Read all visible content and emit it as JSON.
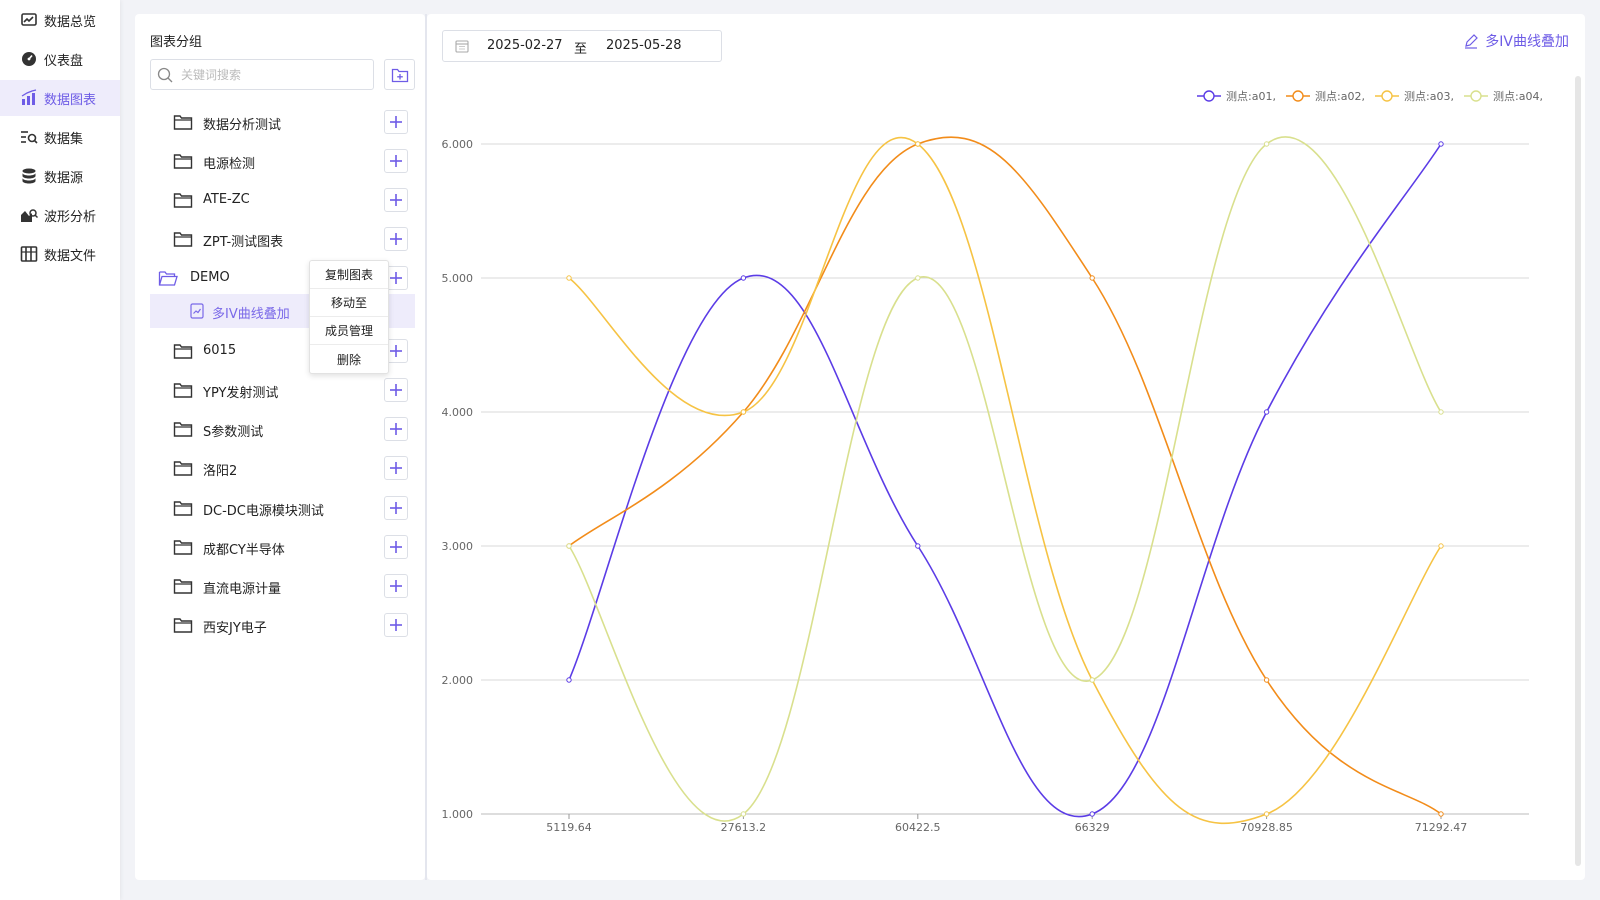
{
  "nav": {
    "items": [
      {
        "label": "数据总览",
        "icon": "chart-monitor-icon",
        "active": false
      },
      {
        "label": "仪表盘",
        "icon": "dashboard-gauge-icon",
        "active": false
      },
      {
        "label": "数据图表",
        "icon": "bar-chart-icon",
        "active": true
      },
      {
        "label": "数据集",
        "icon": "dataset-search-icon",
        "active": false
      },
      {
        "label": "数据源",
        "icon": "database-icon",
        "active": false
      },
      {
        "label": "波形分析",
        "icon": "waveform-analysis-icon",
        "active": false
      },
      {
        "label": "数据文件",
        "icon": "data-files-icon",
        "active": false
      }
    ]
  },
  "sidebar": {
    "title": "图表分组",
    "search_placeholder": "关键词搜索",
    "tree": [
      {
        "label": "数据分析测试"
      },
      {
        "label": "电源检测"
      },
      {
        "label": "ATE-ZC"
      },
      {
        "label": "ZPT-测试图表"
      },
      {
        "label": "DEMO",
        "expanded": true
      },
      {
        "label": "多IV曲线叠加",
        "child": true,
        "selected": true
      },
      {
        "label": "6015"
      },
      {
        "label": "YPY发射测试"
      },
      {
        "label": "S参数测试"
      },
      {
        "label": "洛阳2"
      },
      {
        "label": "DC-DC电源模块测试"
      },
      {
        "label": "成都CY半导体"
      },
      {
        "label": "直流电源计量"
      },
      {
        "label": "西安JY电子"
      }
    ]
  },
  "context_menu": {
    "items": [
      "复制图表",
      "移动至",
      "成员管理",
      "删除"
    ]
  },
  "main": {
    "date_start": "2025-02-27",
    "date_separator": "至",
    "date_end": "2025-05-28",
    "chart_title": "多IV曲线叠加"
  },
  "colors": {
    "accent": "#6e5ce6",
    "series_a01": "#5b3ce6",
    "series_a02": "#f28c1a",
    "series_a03": "#f6c344",
    "series_a04": "#d9e08e"
  },
  "chart_data": {
    "type": "line",
    "smooth": true,
    "categories": [
      "5119.64",
      "27613.2",
      "60422.5",
      "66329",
      "70928.85",
      "71292.47"
    ],
    "y_ticks": [
      "1.000",
      "2.000",
      "3.000",
      "4.000",
      "5.000",
      "6.000"
    ],
    "ylim": [
      1,
      6
    ],
    "grid": "horizontal",
    "legend_position": "top-right",
    "series": [
      {
        "name": "测点:a01,",
        "color": "#5b3ce6",
        "values": [
          2,
          5,
          3,
          1,
          4,
          6
        ]
      },
      {
        "name": "测点:a02,",
        "color": "#f28c1a",
        "values": [
          3,
          4,
          6,
          5,
          2,
          1
        ]
      },
      {
        "name": "测点:a03,",
        "color": "#f6c344",
        "values": [
          5,
          4,
          6,
          2,
          1,
          3
        ]
      },
      {
        "name": "测点:a04,",
        "color": "#d9e08e",
        "values": [
          3,
          1,
          5,
          2,
          6,
          4
        ]
      }
    ]
  }
}
